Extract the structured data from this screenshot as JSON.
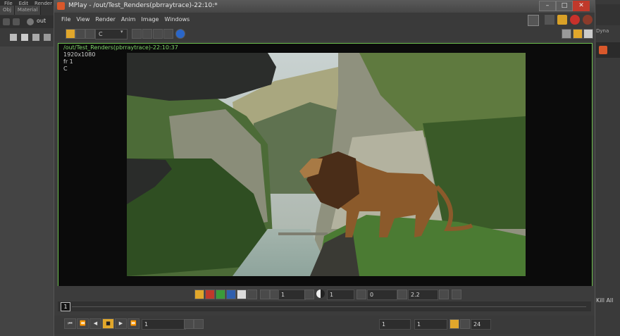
{
  "background": {
    "menus": [
      "File",
      "Edit",
      "Render"
    ],
    "tabs": [
      "Obj",
      "Material"
    ],
    "toolbar_path": "out",
    "right_label": "Dyna",
    "right_bottom_label": "Kill All"
  },
  "window": {
    "title": "MPlay - /out/Test_Renders(pbrraytrace)-22:10:*"
  },
  "menu": [
    "File",
    "View",
    "Render",
    "Anim",
    "Image",
    "Windows"
  ],
  "toolbar": {
    "channel": "C"
  },
  "viewer": {
    "info": {
      "path": "/out/Test_Renders(pbrraytrace)-22:10:37",
      "resolution": "1920x1080",
      "frame": "fr 1",
      "channel": "C"
    }
  },
  "controls": {
    "field1": "1",
    "field2": "1",
    "field3": "0",
    "gamma": "2.2"
  },
  "timeline": {
    "frame": "1"
  },
  "playbar": {
    "current_frame": "1",
    "start": "1",
    "end": "1",
    "fps": "24"
  },
  "colors": {
    "accent": "#6ec04e",
    "selected": "#e1a72b",
    "title": "#464646"
  }
}
